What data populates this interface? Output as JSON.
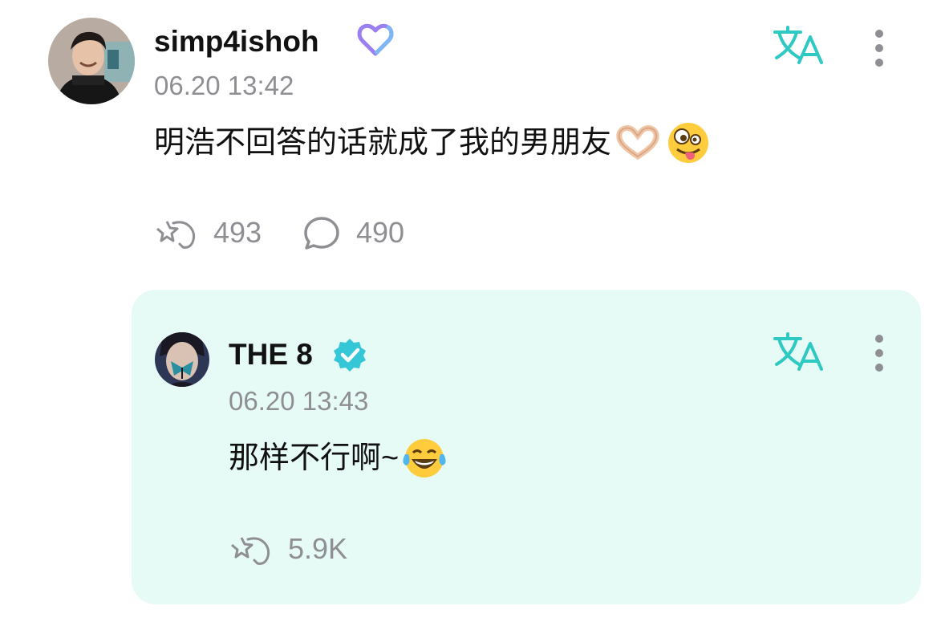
{
  "post": {
    "username": "simp4ishoh",
    "timestamp": "06.20 13:42",
    "text": "明浩不回答的话就成了我的男朋友",
    "likes": "493",
    "comments": "490",
    "badge_icon": "heart-outline-icon",
    "avatar_icon": "user-photo-icon"
  },
  "reply": {
    "username": "THE 8",
    "timestamp": "06.20 13:43",
    "text": "那样不行啊~",
    "likes": "5.9K",
    "badge_icon": "verified-check-icon",
    "avatar_icon": "artist-photo-icon"
  },
  "colors": {
    "accent": "#2ec9c2",
    "verified": "#35c6d8",
    "heart_badge": "#9a7ff0",
    "muted": "#8e8e93",
    "reply_bg": "#e6faf6"
  },
  "icons": {
    "translate": "translate-icon",
    "more": "more-vertical-icon",
    "like": "star-hand-like-icon",
    "comment": "comment-bubble-icon",
    "heart_hands": "heart-hands-emoji",
    "zany_face": "zany-face-emoji",
    "tears_of_joy": "tears-of-joy-emoji"
  }
}
